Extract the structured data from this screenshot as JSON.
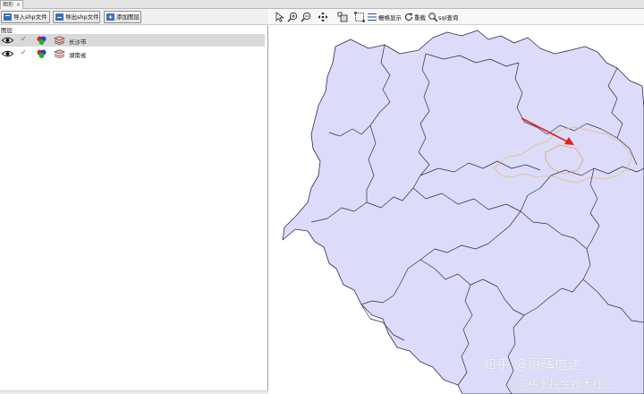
{
  "tab": {
    "label": "图形",
    "close": "×"
  },
  "toolbar_left": {
    "import_shp": "导入shp文件",
    "export_shp": "导出shp文件",
    "add_layer": "添加图层"
  },
  "layers": {
    "header": "图层",
    "items": [
      {
        "name": "长沙市",
        "selected": true,
        "checked": true
      },
      {
        "name": "湖南省",
        "selected": false,
        "checked": true
      }
    ]
  },
  "toolbar_map": {
    "grid_show": "栅格显示",
    "reload": "重载",
    "sql_query": "sql查询"
  },
  "colors": {
    "province_fill": "#dcdcfa",
    "border": "#2a2a4a",
    "highlight_outline": "#e5b64a",
    "arrow": "#e02020",
    "selected_row": "#d9d9d9"
  },
  "watermark": {
    "line1": "知乎 @恒辉信达",
    "line2": "@稀土掘金技术社区"
  }
}
